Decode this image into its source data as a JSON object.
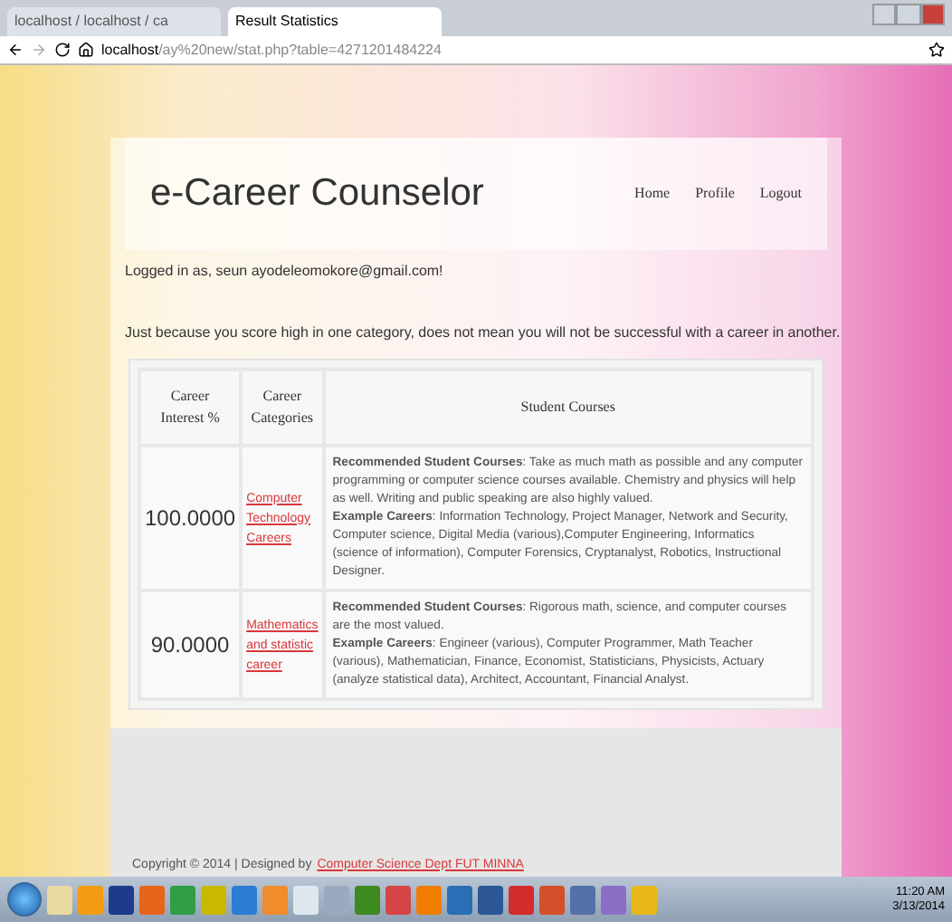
{
  "browser": {
    "tabs": [
      {
        "label": "localhost / localhost / ca",
        "selected": false
      },
      {
        "label": "Result Statistics",
        "selected": true
      }
    ],
    "url_host": "localhost",
    "url_path": "/ay%20new/stat.php?table=4271201484224"
  },
  "header": {
    "title": "e-Career Counselor",
    "nav": [
      "Home",
      "Profile",
      "Logout"
    ]
  },
  "logged_in": "Logged in as, seun ayodeleomokore@gmail.com!",
  "notice": "Just because you score high in one category, does not mean you will not be successful with a career in another.",
  "table": {
    "columns": [
      "Career Interest %",
      "Career Categories",
      "Student Courses"
    ],
    "rows": [
      {
        "interest": "100.0000",
        "category": "Computer Technology Careers",
        "courses": "**Recommended Student Courses**: Take as much math as possible and any computer programming or computer science courses available. Chemistry and physics will help as well. Writing and public speaking are also highly valued.",
        "careers": "**Example Careers**: Information Technology, Project Manager, Network and Security, Computer science, Digital Media (various),Computer Engineering, Informatics (science of information), Computer Forensics, Cryptanalyst, Robotics, Instructional Designer."
      },
      {
        "interest": "90.0000",
        "category": "Mathematics and statistic career",
        "courses": "**Recommended Student Courses**: Rigorous math, science, and computer courses are the most valued.",
        "careers": "**Example Careers**: Engineer (various), Computer Programmer, Math Teacher (various), Mathematician, Finance, Economist, Statisticians, Physicists, Actuary (analyze statistical data), Architect, Accountant, Financial Analyst."
      }
    ]
  },
  "footer": {
    "text": "Copyright © 2014 | Designed by",
    "link": "Computer Science Dept FUT MINNA"
  },
  "taskbar": {
    "time": "11:20 AM",
    "date": "3/13/2014"
  }
}
